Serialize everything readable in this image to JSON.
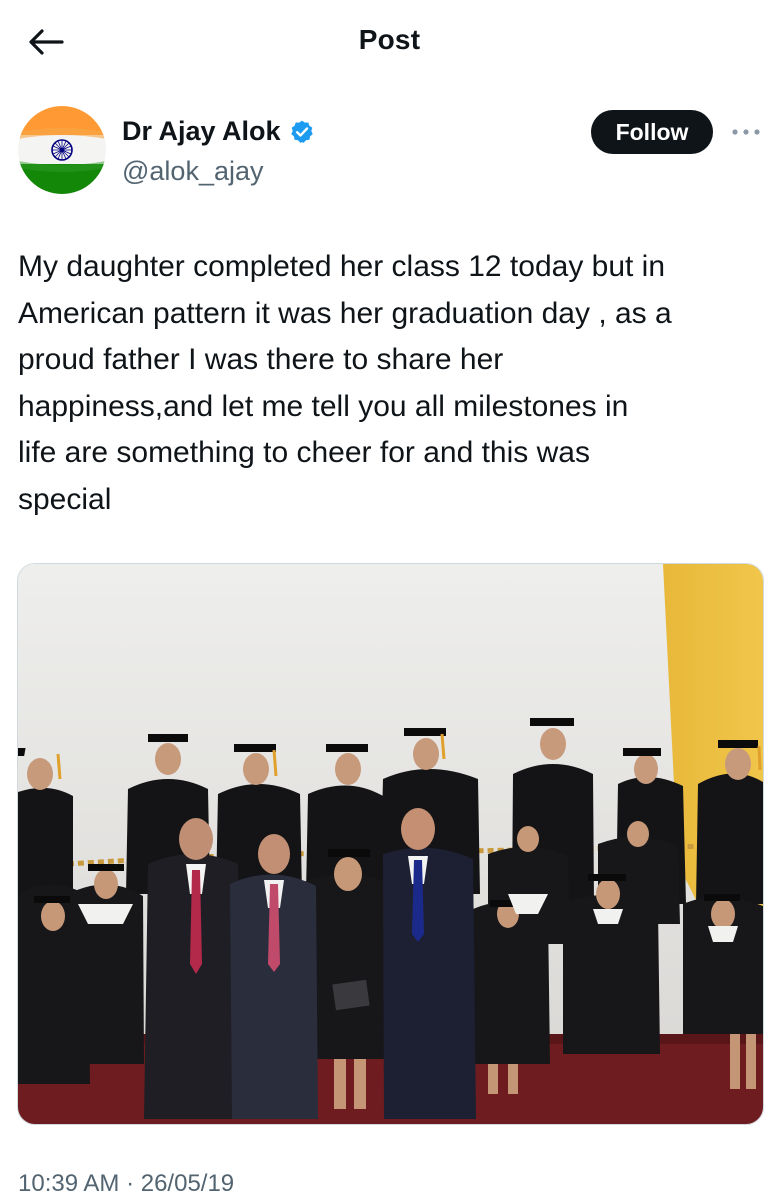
{
  "header": {
    "title": "Post",
    "back_icon": "arrow-left-icon"
  },
  "author": {
    "name": "Dr Ajay Alok",
    "handle": "@alok_ajay",
    "verified": true,
    "avatar": "india-flag-avatar",
    "follow_label": "Follow"
  },
  "tweet": {
    "text": "My daughter completed her class 12 today but in\nAmerican pattern it was her graduation day , as a\nproud father I was there to share her\nhappiness,and let me tell you all milestones in\nlife are something to cheer for and this was\nspecial",
    "image": "graduation-group-photo",
    "timestamp": "10:39 AM · 26/05/19"
  },
  "colors": {
    "text": "#0f1419",
    "secondary": "#536471",
    "verified_blue": "#1d9bf0",
    "follow_bg": "#0f1419",
    "saffron": "#ff9933",
    "india_green": "#138808",
    "chakra_blue": "#000080"
  }
}
